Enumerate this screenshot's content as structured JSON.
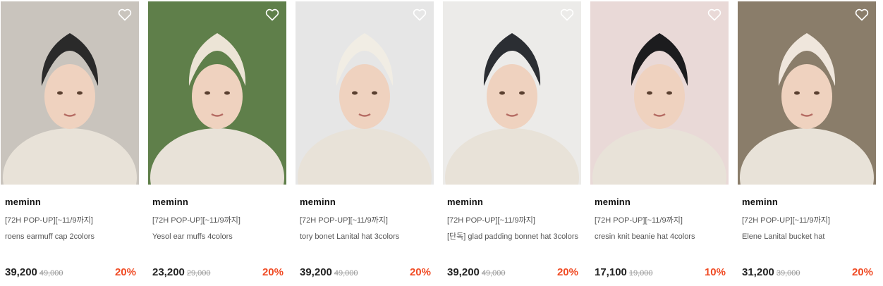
{
  "products": [
    {
      "brand": "meminn",
      "promo": "[72H POP-UP][~11/9까지]",
      "name": "roens earmuff cap 2colors",
      "price": "39,200",
      "original_price": "49,000",
      "discount": "20%",
      "hat_color": "#2a2a2a",
      "bg_color": "#c9c4bd",
      "icon": "heart-outline-icon"
    },
    {
      "brand": "meminn",
      "promo": "[72H POP-UP][~11/9까지]",
      "name": "Yesol ear muffs 4colors",
      "price": "23,200",
      "original_price": "29,000",
      "discount": "20%",
      "hat_color": "#ece4d6",
      "bg_color": "#5f7f4a",
      "icon": "heart-outline-icon"
    },
    {
      "brand": "meminn",
      "promo": "[72H POP-UP][~11/9까지]",
      "name": "tory bonet Lanital hat 3colors",
      "price": "39,200",
      "original_price": "49,000",
      "discount": "20%",
      "hat_color": "#f1ede4",
      "bg_color": "#e6e6e6",
      "icon": "heart-outline-icon"
    },
    {
      "brand": "meminn",
      "promo": "[72H POP-UP][~11/9까지]",
      "name": "[단독] glad padding bonnet hat 3colors",
      "price": "39,200",
      "original_price": "49,000",
      "discount": "20%",
      "hat_color": "#2b2e33",
      "bg_color": "#ecebe9",
      "icon": "heart-outline-icon"
    },
    {
      "brand": "meminn",
      "promo": "[72H POP-UP][~11/9까지]",
      "name": "cresin knit beanie hat 4colors",
      "price": "17,100",
      "original_price": "19,000",
      "discount": "10%",
      "hat_color": "#1c1c1e",
      "bg_color": "#e9d9d7",
      "icon": "heart-outline-icon"
    },
    {
      "brand": "meminn",
      "promo": "[72H POP-UP][~11/9까지]",
      "name": "Elene Lanital bucket hat",
      "price": "31,200",
      "original_price": "39,000",
      "discount": "20%",
      "hat_color": "#efe6dc",
      "bg_color": "#8a7d6a",
      "icon": "heart-outline-icon"
    }
  ],
  "colors": {
    "discount": "#f04a23",
    "text": "#222222",
    "muted": "#999999"
  }
}
